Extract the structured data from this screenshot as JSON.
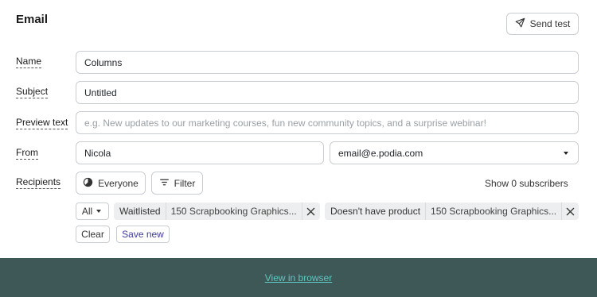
{
  "header": {
    "title": "Email",
    "send_test_label": "Send test",
    "send_test_icon": "paper-plane-icon"
  },
  "form": {
    "name": {
      "label": "Name",
      "value": "Columns"
    },
    "subject": {
      "label": "Subject",
      "value": "Untitled"
    },
    "preview": {
      "label": "Preview text",
      "value": "",
      "placeholder": "e.g. New updates to our marketing courses, fun new community topics, and a surprise webinar!"
    },
    "from": {
      "label": "From",
      "name_value": "Nicola",
      "email_value": "email@e.podia.com"
    },
    "recipients": {
      "label": "Recipients",
      "everyone_label": "Everyone",
      "everyone_icon": "pie-chart-icon",
      "filter_label": "Filter",
      "filter_icon": "filter-lines-icon",
      "subscriber_count_text": "Show 0 subscribers",
      "match_mode": "All",
      "filters": [
        {
          "key": "Waitlisted",
          "value": "150 Scrapbooking Graphics..."
        },
        {
          "key": "Doesn't have product",
          "value": "150 Scrapbooking Graphics..."
        }
      ],
      "clear_label": "Clear",
      "save_new_label": "Save new"
    }
  },
  "footer": {
    "link_text": "View in browser"
  },
  "colors": {
    "footer_bg": "#3d5857",
    "footer_link": "#5fc7c1",
    "accent_text": "#3f3a9a",
    "border": "#c9cdd1",
    "chip_bg": "#eceeef"
  }
}
